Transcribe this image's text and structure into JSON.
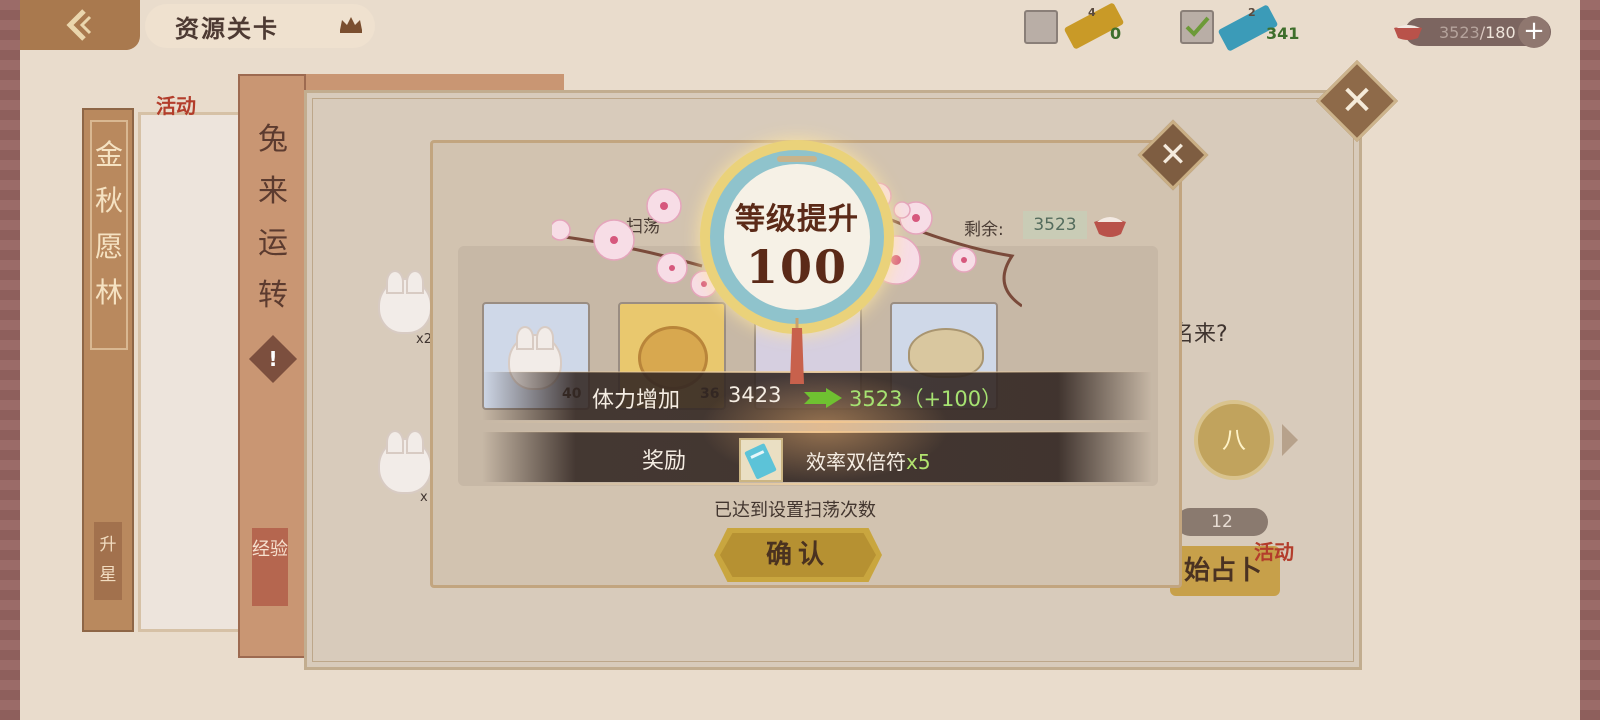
{
  "topbar": {
    "back_icon": "chevron-left-icon",
    "title": "资源关卡",
    "crown_icon": "crown-icon",
    "resource1_value": "0",
    "resource1_small": "4",
    "resource2_value": "341",
    "resource2_small": "2",
    "stamina_current": "3523",
    "stamina_sep": "/",
    "stamina_max": "180",
    "plus_label": "+"
  },
  "cards": {
    "card1_title": "金秋愿林",
    "card1_tag": "活动",
    "card1_sub": "升星",
    "card2_title": "兔来运转",
    "card2_warn": "!",
    "card2_sub": "经验"
  },
  "panel": {
    "close_label": "✕",
    "question_text": "名来?",
    "circle_label": "八",
    "count_value": "12",
    "start_label": "始占卜",
    "start_tag": "活动"
  },
  "dialog": {
    "close_label": "✕",
    "sweep_label": "扫荡",
    "remain_label": "剩余:",
    "remain_value": "3523",
    "items": [
      {
        "name": "bunny-dumpling",
        "count": "40",
        "color": "#cfd8e8"
      },
      {
        "name": "mooncake",
        "count": "36",
        "color": "#e9c86e"
      },
      {
        "name": "bunny-dumpling-2",
        "count": "",
        "color": "#d6cfe0"
      },
      {
        "name": "dumpling",
        "count": "",
        "color": "#cfd8e8"
      }
    ],
    "side_items": [
      {
        "label": "x2"
      },
      {
        "label": "x"
      }
    ],
    "reached_text": "已达到设置扫荡次数",
    "confirm_label": "确认"
  },
  "levelup": {
    "title": "等级提升",
    "level": "100",
    "stat_label": "体力增加",
    "stat_old": "3423",
    "stat_new": "3523（+100）",
    "reward_label": "奖励",
    "reward_icon": "ticket-icon",
    "reward_name": "效率双倍符",
    "reward_qty": "x5"
  },
  "colors": {
    "stat_new": "#a6e271",
    "gold": "#c9a63f",
    "medal_ring": "#8fc3cc"
  }
}
